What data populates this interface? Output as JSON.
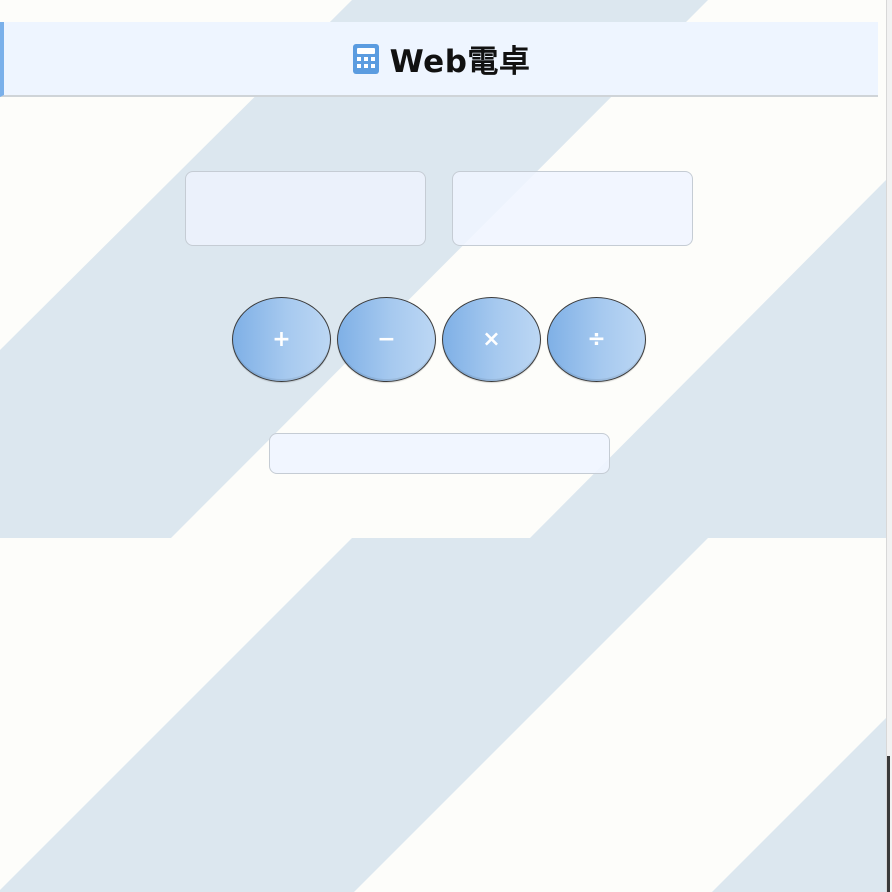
{
  "app": {
    "title": "Web電卓",
    "title_icon": "calculator-icon"
  },
  "inputs": {
    "first_value": "",
    "second_value": ""
  },
  "operators": [
    {
      "symbol": "+",
      "icon": "plus"
    },
    {
      "symbol": "−",
      "icon": "minus"
    },
    {
      "symbol": "×",
      "icon": "multiply"
    },
    {
      "symbol": "÷",
      "icon": "divide"
    }
  ],
  "result": {
    "value": ""
  },
  "colors": {
    "background": "#fdfdfa",
    "stripe": "#dce7ef",
    "header_bg": "#eef5ff",
    "header_accent": "#7ab0ea",
    "button_gradient_start": "#7fb0e6",
    "button_gradient_end": "#bcd7f4",
    "button_text": "#ffffff",
    "icon_blue": "#5b9ce0"
  }
}
